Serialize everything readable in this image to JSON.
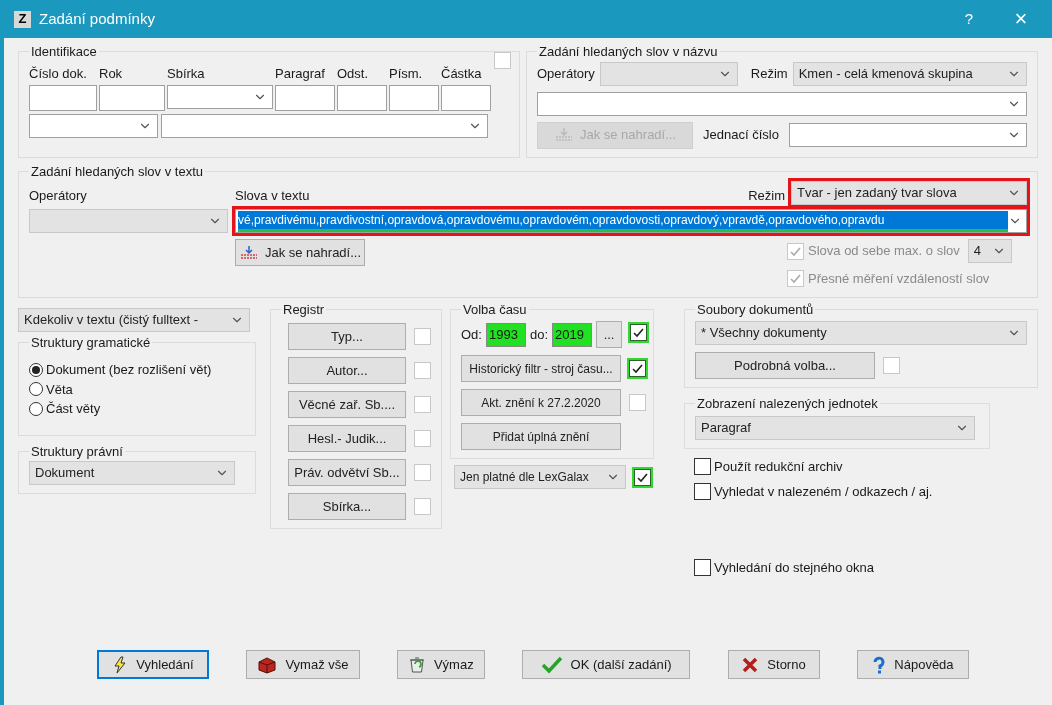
{
  "window": {
    "icon_letter": "Z",
    "title": "Zadání podmínky",
    "help": "?",
    "close": "×"
  },
  "identifikace": {
    "title": "Identifikace",
    "checked": false,
    "labels": [
      "Číslo dok.",
      "Rok",
      "Sbírka",
      "Paragraf",
      "Odst.",
      "Písm.",
      "Částka"
    ]
  },
  "nazev": {
    "title": "Zadání hledaných slov v názvu",
    "operatory_label": "Operátory",
    "rezim_label": "Režim",
    "rezim_value": "Kmen - celá kmenová skupina",
    "jak_button": {
      "label": "Jak se nahradí...",
      "disabled": true
    },
    "jednaci_label": "Jednací číslo"
  },
  "text": {
    "title": "Zadání hledaných slov v textu",
    "operatory_label": "Operátory",
    "slova_label": "Slova v textu",
    "rezim_label": "Režim",
    "rezim_value": "Tvar - jen zadaný tvar slova",
    "rezim_highlighted": true,
    "words_value": "vé,pravdivému,pravdivostní,opravdová,opravdovému,opravdovém,opravdovosti,opravdový,vpravdě,opravdového,opravdu",
    "words_highlighted": true,
    "words_selected": true,
    "jak_button": {
      "label": "Jak se nahradí...",
      "disabled": false
    },
    "distance": {
      "label": "Slova od sebe max. o slov",
      "checked": true,
      "disabled": true,
      "value": "4"
    },
    "exact": {
      "label": "Přesné měření vzdáleností slov",
      "checked": true,
      "disabled": true
    }
  },
  "scope_value": "Kdekoliv v textu (čistý fulltext -",
  "struktury_gramaticke": {
    "title": "Struktury gramatické",
    "options": [
      {
        "label": "Dokument (bez rozlišení vět)",
        "selected": true
      },
      {
        "label": "Věta",
        "selected": false
      },
      {
        "label": "Část věty",
        "selected": false
      }
    ]
  },
  "struktury_pravni": {
    "title": "Struktury právní",
    "value": "Dokument"
  },
  "registr": {
    "title": "Registr",
    "items": [
      {
        "label": "Typ...",
        "checked": false
      },
      {
        "label": "Autor...",
        "checked": false
      },
      {
        "label": "Věcné zař. Sb....",
        "checked": false
      },
      {
        "label": "Hesl.- Judik...",
        "checked": false
      },
      {
        "label": "Práv. odvětví Sb...",
        "checked": false
      },
      {
        "label": "Sbírka...",
        "checked": false
      }
    ]
  },
  "volba_casu": {
    "title": "Volba času",
    "od_label": "Od:",
    "od_value": "1993",
    "do_label": "do:",
    "do_value": "2019",
    "years_highlighted": true,
    "dots": "...",
    "range_checked": true,
    "items": [
      {
        "label": "Historický filtr - stroj času...",
        "kind": "check",
        "checked": true
      },
      {
        "label": "Akt. znění k 27.2.2020",
        "kind": "check",
        "checked": false
      },
      {
        "label": "Přidat úplná znění",
        "kind": "plain"
      }
    ]
  },
  "platne": {
    "value": "Jen platné dle LexGalax",
    "checked": true
  },
  "soubory": {
    "title": "Soubory dokumentů",
    "value": "* Všechny dokumenty",
    "button": "Podrobná volba...",
    "checked": false
  },
  "zobrazeni": {
    "title": "Zobrazení nalezených jednotek",
    "value": "Paragraf"
  },
  "checkboxes": [
    {
      "label": "Použít redukční archiv",
      "checked": false
    },
    {
      "label": "Vyhledat v nalezeném / odkazech / aj.",
      "checked": false
    },
    {
      "label": "Vyhledání do stejného okna",
      "checked": false
    }
  ],
  "buttons": [
    {
      "label": "Vyhledání",
      "kind": "search",
      "default": true
    },
    {
      "label": "Vymaž vše",
      "kind": "clear_all",
      "default": false
    },
    {
      "label": "Výmaz",
      "kind": "clear",
      "default": false
    },
    {
      "label": "OK (další zadání)",
      "kind": "ok",
      "default": false
    },
    {
      "label": "Storno",
      "kind": "cancel",
      "default": false
    },
    {
      "label": "Nápověda",
      "kind": "help",
      "default": false
    }
  ]
}
